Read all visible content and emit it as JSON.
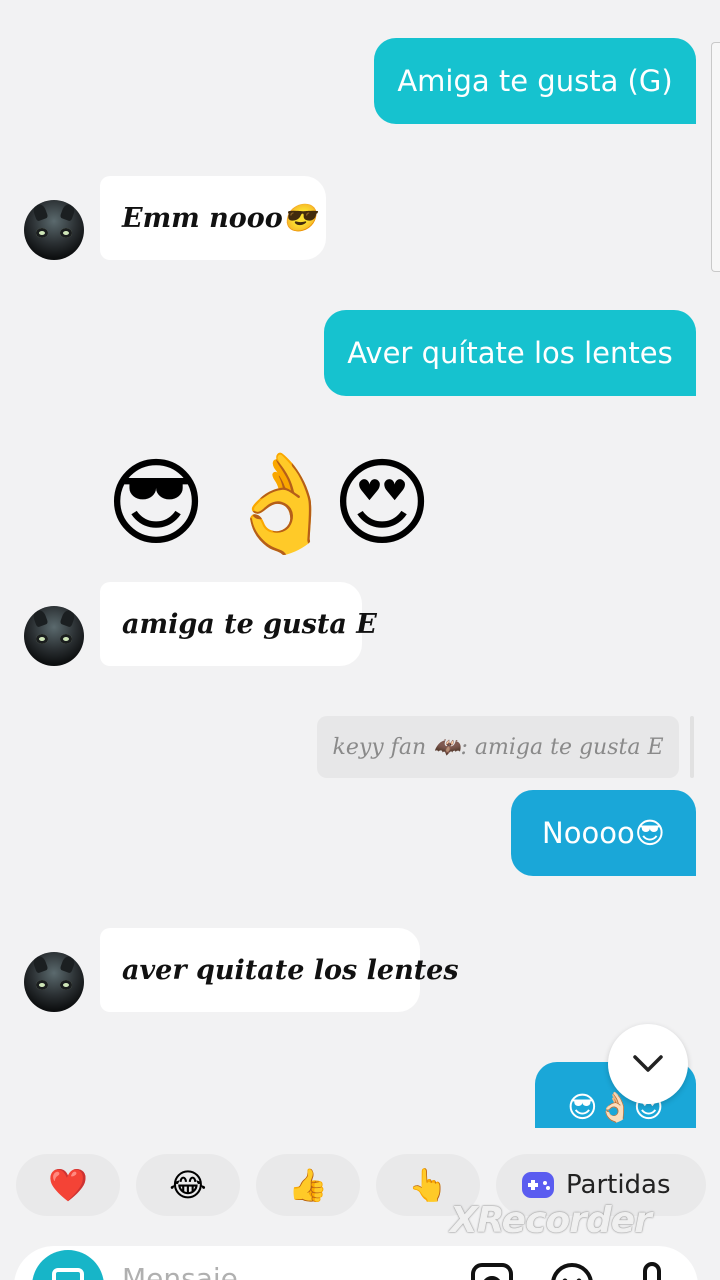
{
  "messages": {
    "out_1": "Amiga te gusta (G)",
    "in_1": "Emm nooo😎",
    "out_2": "Aver quítate los lentes",
    "emojis": [
      "😎",
      "👌",
      "😍"
    ],
    "in_2": "amiga te gusta E",
    "quote": "keyy fan 🦇: amiga te gusta E",
    "out_3": "Noooo😎",
    "in_3": "aver quitate los lentes",
    "out_4": "😎👌🏻😍"
  },
  "reactions": [
    "❤️",
    "😂",
    "👍",
    "👆"
  ],
  "partidas_label": "Partidas",
  "input": {
    "placeholder": "Mensaje"
  },
  "watermark": "XRecorder",
  "colors": {
    "out_teal": "#16c2cf",
    "out_blue": "#1aa7d8",
    "camera": "#17b5c8",
    "game": "#5a5cf0"
  }
}
